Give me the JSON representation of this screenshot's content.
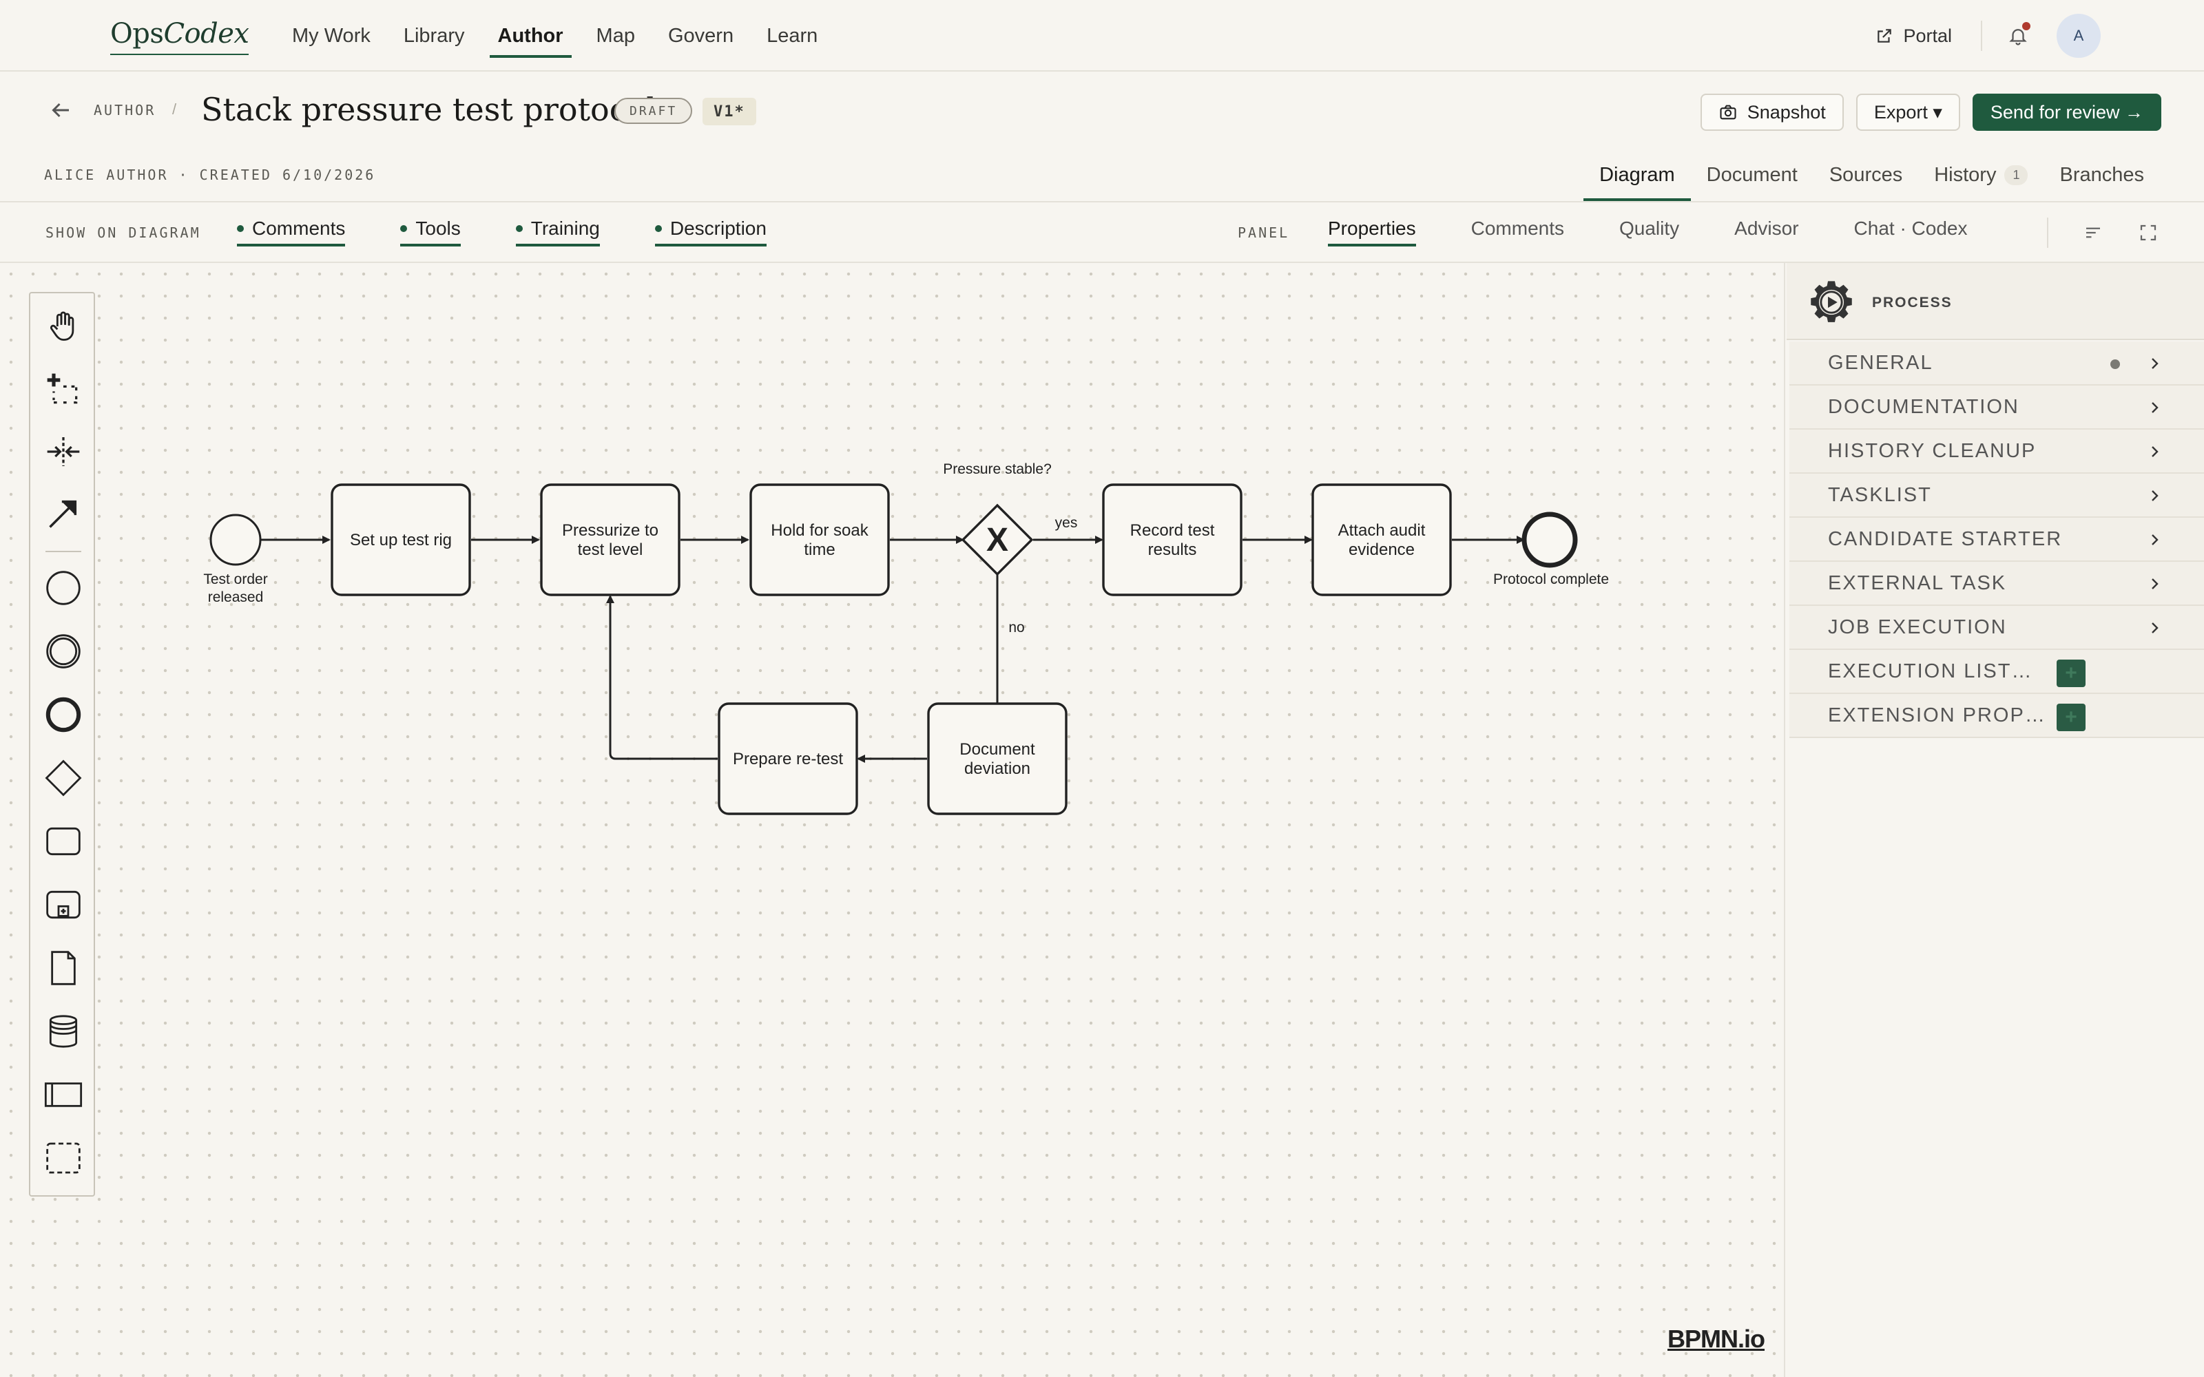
{
  "brand": {
    "name_a": "Ops",
    "name_b": "Codex"
  },
  "nav": {
    "items": [
      "My Work",
      "Library",
      "Author",
      "Map",
      "Govern",
      "Learn"
    ],
    "active": "Author"
  },
  "top_right": {
    "portal_label": "Portal",
    "avatar_initial": "A",
    "bell_icon": "bell-icon"
  },
  "header": {
    "breadcrumb": "AUTHOR",
    "breadcrumb_sep": "/",
    "title": "Stack pressure test protocol",
    "status_badge": "DRAFT",
    "version_badge": "V1*",
    "meta": "ALICE AUTHOR · CREATED 6/10/2026",
    "snapshot_label": "Snapshot",
    "export_label": "Export ▾",
    "send_label": "Send for review →"
  },
  "view_tabs": [
    {
      "label": "Diagram",
      "active": true
    },
    {
      "label": "Document"
    },
    {
      "label": "Sources"
    },
    {
      "label": "History",
      "count": "1"
    },
    {
      "label": "Branches"
    }
  ],
  "show_on_diagram": {
    "label": "SHOW ON DIAGRAM",
    "toggles": [
      "Comments",
      "Tools",
      "Training",
      "Description"
    ]
  },
  "panel": {
    "label": "PANEL",
    "tabs": [
      "Properties",
      "Comments",
      "Quality",
      "Advisor",
      "Chat · Codex"
    ],
    "active": "Properties"
  },
  "diagram": {
    "start_label": [
      "Test order",
      "released"
    ],
    "end_label": "Protocol complete",
    "gateway_label": "Pressure stable?",
    "gateway_symbol": "X",
    "flow_yes": "yes",
    "flow_no": "no",
    "tasks": {
      "setup": [
        "Set up test rig"
      ],
      "pressurize": [
        "Pressurize to",
        "test level"
      ],
      "hold": [
        "Hold for soak",
        "time"
      ],
      "record": [
        "Record test",
        "results"
      ],
      "attach": [
        "Attach audit",
        "evidence"
      ],
      "document": [
        "Document",
        "deviation"
      ],
      "prepare": [
        "Prepare re-test"
      ]
    },
    "watermark": "BPMN.io"
  },
  "properties": {
    "header": "PROCESS",
    "groups": [
      {
        "label": "GENERAL",
        "dot": true
      },
      {
        "label": "DOCUMENTATION"
      },
      {
        "label": "HISTORY CLEANUP"
      },
      {
        "label": "TASKLIST"
      },
      {
        "label": "CANDIDATE STARTER"
      },
      {
        "label": "EXTERNAL TASK"
      },
      {
        "label": "JOB EXECUTION"
      },
      {
        "label": "EXECUTION LIST…",
        "add": true
      },
      {
        "label": "EXTENSION PROP…",
        "add": true
      }
    ]
  },
  "colors": {
    "accent": "#1f5a3e",
    "background": "#f7f5f0",
    "notification": "#b03a2e"
  }
}
